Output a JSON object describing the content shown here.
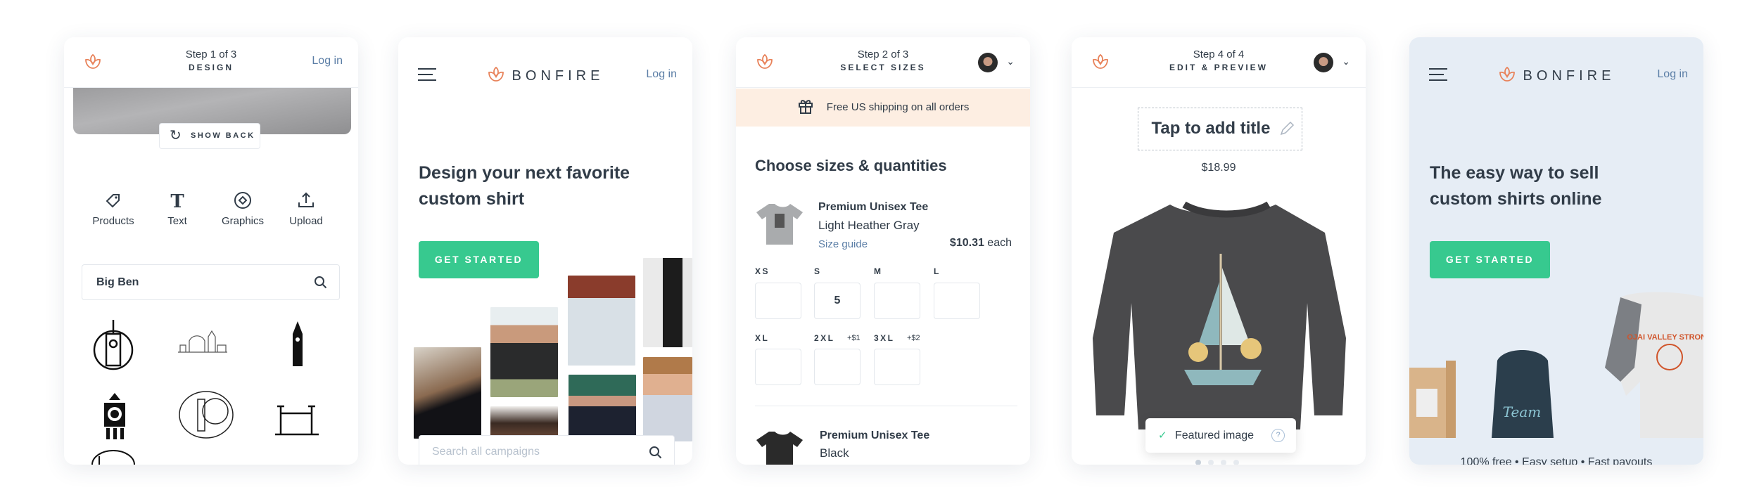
{
  "colors": {
    "accent": "#e8825a",
    "green": "#37c98f",
    "link": "#5b7ea6",
    "text": "#313c48",
    "banner": "#fdeee2",
    "hero_bg": "#e6edf5"
  },
  "card1": {
    "step": "Step 1 of 3",
    "step_name": "DESIGN",
    "login": "Log in",
    "show_back": "SHOW BACK",
    "tools": [
      {
        "label": "Products",
        "icon": "tag-icon"
      },
      {
        "label": "Text",
        "icon": "text-icon"
      },
      {
        "label": "Graphics",
        "icon": "graphics-icon"
      },
      {
        "label": "Upload",
        "icon": "upload-icon"
      }
    ],
    "search_value": "Big Ben"
  },
  "card2": {
    "brand": "BONFIRE",
    "login": "Log in",
    "headline_1": "Design your next favorite",
    "headline_2": "custom shirt",
    "cta": "GET STARTED",
    "search_placeholder": "Search all campaigns"
  },
  "card3": {
    "step": "Step 2 of 3",
    "step_name": "SELECT SIZES",
    "banner": "Free US shipping on all orders",
    "heading": "Choose sizes & quantities",
    "products": [
      {
        "name": "Premium Unisex Tee",
        "color": "Light Heather Gray",
        "size_guide": "Size guide",
        "price": "$10.31",
        "price_suffix": " each"
      },
      {
        "name": "Premium Unisex Tee",
        "color": "Black"
      }
    ],
    "sizes": [
      {
        "label": "XS",
        "qty": ""
      },
      {
        "label": "S",
        "qty": "5"
      },
      {
        "label": "M",
        "qty": ""
      },
      {
        "label": "L",
        "qty": ""
      },
      {
        "label": "XL",
        "qty": "",
        "extra": ""
      },
      {
        "label": "2XL",
        "qty": "",
        "extra": "+$1"
      },
      {
        "label": "3XL",
        "qty": "",
        "extra": "+$2"
      }
    ]
  },
  "card4": {
    "step": "Step 4 of 4",
    "step_name": "EDIT & PREVIEW",
    "title_placeholder": "Tap to add title",
    "price": "$18.99",
    "featured": "Featured image",
    "help": "?"
  },
  "card5": {
    "brand": "BONFIRE",
    "login": "Log in",
    "headline_1": "The easy way to sell",
    "headline_2": "custom shirts online",
    "cta": "GET STARTED",
    "footer": "100% free • Easy setup • Fast payouts"
  }
}
